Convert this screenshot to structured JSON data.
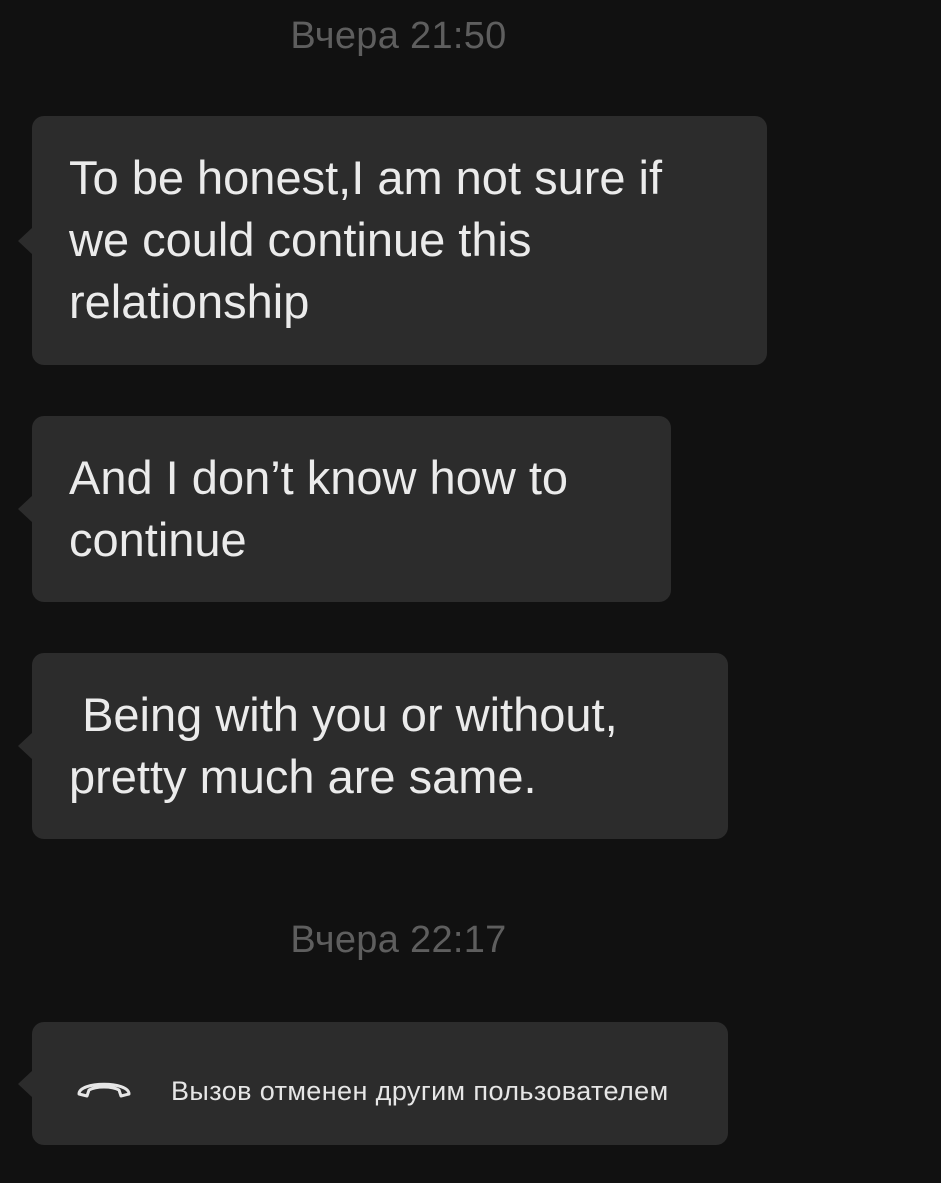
{
  "chat": {
    "timestamps": [
      "Вчера 21:50",
      "Вчера 22:17"
    ],
    "messages": [
      {
        "text": "To be honest,I am not sure if\nwe could continue this\nrelationship"
      },
      {
        "text": "And I don’t know how to\ncontinue"
      },
      {
        "text": " Being with you or without,\npretty much are same."
      }
    ],
    "call_event": {
      "icon": "hang-up-phone-icon",
      "text": "Вызов отменен другим пользователем"
    }
  },
  "colors": {
    "background": "#111111",
    "bubble": "#2c2c2c",
    "message_text": "#ebebeb",
    "timestamp": "#5e5e5e"
  }
}
